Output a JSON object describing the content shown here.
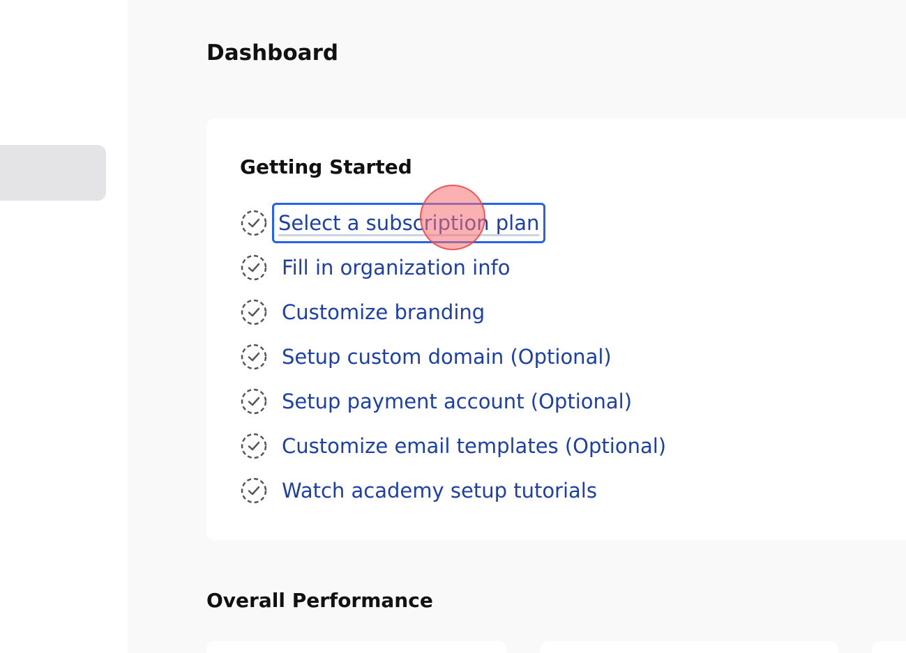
{
  "page": {
    "title": "Dashboard"
  },
  "getting_started": {
    "title": "Getting Started",
    "items": [
      {
        "label": "Select a subscription plan",
        "icon": "dashed-check-circle-icon"
      },
      {
        "label": "Fill in organization info",
        "icon": "dashed-check-circle-icon"
      },
      {
        "label": "Customize branding",
        "icon": "dashed-check-circle-icon"
      },
      {
        "label": "Setup custom domain (Optional)",
        "icon": "dashed-check-circle-icon"
      },
      {
        "label": "Setup payment account (Optional)",
        "icon": "dashed-check-circle-icon"
      },
      {
        "label": "Customize email templates (Optional)",
        "icon": "dashed-check-circle-icon"
      },
      {
        "label": "Watch academy setup tutorials",
        "icon": "dashed-check-circle-icon"
      }
    ]
  },
  "overall_performance": {
    "title": "Overall Performance"
  },
  "colors": {
    "link": "#1d3fa8",
    "focus_ring": "#2563eb",
    "background": "#f9f9f9",
    "sidebar_active": "#e4e4e7"
  }
}
